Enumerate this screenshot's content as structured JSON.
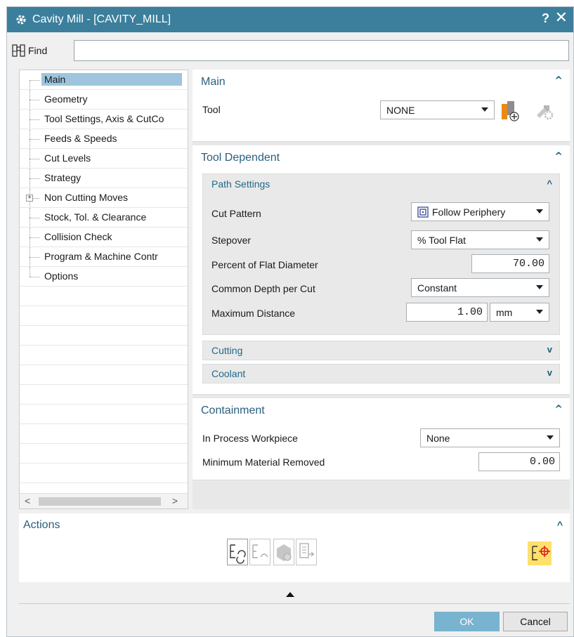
{
  "window": {
    "title": "Cavity Mill - [CAVITY_MILL]",
    "help": "?",
    "close": "✕"
  },
  "find": {
    "label": "Find",
    "value": ""
  },
  "tree": {
    "items": [
      {
        "label": "Main",
        "selected": true
      },
      {
        "label": "Geometry"
      },
      {
        "label": "Tool Settings, Axis & CutCo"
      },
      {
        "label": "Feeds & Speeds"
      },
      {
        "label": "Cut Levels"
      },
      {
        "label": "Strategy"
      },
      {
        "label": "Non Cutting Moves",
        "expandable": true
      },
      {
        "label": "Stock, Tol. & Clearance"
      },
      {
        "label": "Collision Check"
      },
      {
        "label": "Program & Machine Contr"
      },
      {
        "label": "Options"
      }
    ],
    "expander_symbol": "+",
    "scroll_left": "<",
    "scroll_right": ">"
  },
  "main_section": {
    "title": "Main",
    "tool_label": "Tool",
    "tool_value": "NONE"
  },
  "tool_dependent": {
    "title": "Tool Dependent",
    "path_settings": {
      "title": "Path Settings",
      "cut_pattern_label": "Cut Pattern",
      "cut_pattern_value": "Follow Periphery",
      "stepover_label": "Stepover",
      "stepover_value": "% Tool Flat",
      "percent_label": "Percent of Flat Diameter",
      "percent_value": "70.00",
      "depth_label": "Common Depth per Cut",
      "depth_value": "Constant",
      "max_distance_label": "Maximum Distance",
      "max_distance_value": "1.00",
      "max_distance_unit": "mm"
    },
    "cutting_title": "Cutting",
    "coolant_title": "Coolant"
  },
  "containment": {
    "title": "Containment",
    "ipw_label": "In Process Workpiece",
    "ipw_value": "None",
    "min_removed_label": "Minimum Material Removed",
    "min_removed_value": "0.00"
  },
  "actions": {
    "title": "Actions"
  },
  "buttons": {
    "ok": "OK",
    "cancel": "Cancel"
  },
  "colors": {
    "titlebar": "#3b7f9c",
    "accent": "#295f7d",
    "ok": "#78b3cf",
    "generate_highlight": "#ffe06b"
  },
  "icons": {
    "collapse": "^",
    "expand": "v"
  }
}
